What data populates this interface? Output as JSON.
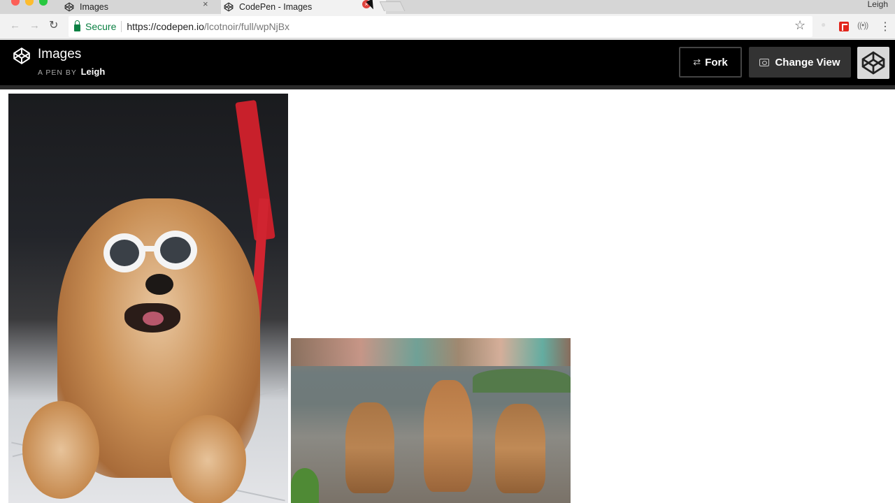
{
  "browser": {
    "tabs": [
      {
        "title": "Images",
        "close": "×"
      },
      {
        "title": "CodePen - Images",
        "close": "×"
      }
    ],
    "profile_name": "Leigh",
    "address_bar": {
      "security_label": "Secure",
      "url_host": "https://codepen.io",
      "url_path": "/lcotnoir/full/wpNjBx"
    },
    "icons": {
      "back": "back-arrow-icon",
      "forward": "forward-arrow-icon",
      "reload": "reload-icon",
      "bookmark": "bookmark-star-icon",
      "menu": "kebab-menu-icon"
    }
  },
  "codepen_header": {
    "pen_title": "Images",
    "by_label": "A PEN BY",
    "author": "Leigh",
    "fork_label": "Fork",
    "change_view_label": "Change View"
  },
  "content": {
    "images": [
      {
        "subject": "chow-chow-with-sunglasses"
      },
      {
        "subject": "three-puppies"
      }
    ]
  },
  "colors": {
    "header_bg": "#000000",
    "secure_green": "#0b8043",
    "change_view_bg": "#333333",
    "tab_close_red": "#e0443e"
  }
}
